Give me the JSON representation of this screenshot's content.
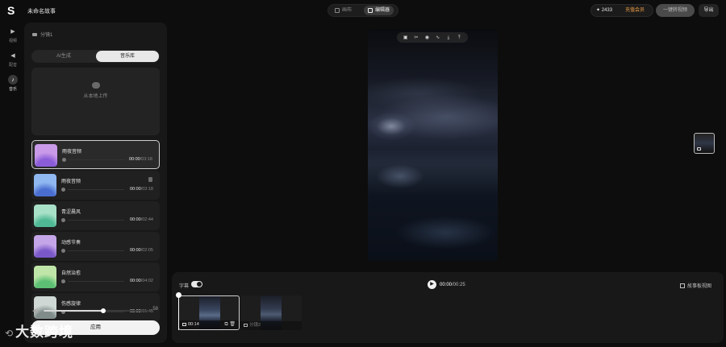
{
  "app": {
    "logo": "S",
    "project_title": "未命名故事"
  },
  "header": {
    "modes": [
      {
        "label": "画布"
      },
      {
        "label": "编辑器"
      }
    ],
    "credits": "✦ 2433",
    "vip": "充值会员",
    "generate": "一键转视频",
    "export": "导出"
  },
  "rail": [
    {
      "label": "视频",
      "icon": "video-icon"
    },
    {
      "label": "配音",
      "icon": "voice-icon"
    },
    {
      "label": "音乐",
      "icon": "music-icon"
    }
  ],
  "panel": {
    "heading": "分镜1",
    "tabs": [
      {
        "label": "AI生成"
      },
      {
        "label": "音乐库"
      }
    ],
    "upload": "从本地上传",
    "tracks": [
      {
        "name": "雨夜音频",
        "current": "00:00",
        "duration": "/03:18",
        "colors": [
          "#8a5cd8",
          "#c99ae8"
        ]
      },
      {
        "name": "雨夜音频",
        "current": "00:00",
        "duration": "/03:18",
        "colors": [
          "#4a6ed0",
          "#8fb8f0"
        ]
      },
      {
        "name": "青涩晨风",
        "current": "00:00",
        "duration": "/02:44",
        "colors": [
          "#4fb894",
          "#a8e0c8"
        ]
      },
      {
        "name": "动感节奏",
        "current": "00:00",
        "duration": "/02:05",
        "colors": [
          "#7a58c8",
          "#c4a6e8"
        ]
      },
      {
        "name": "自然治愈",
        "current": "00:00",
        "duration": "/04:02",
        "colors": [
          "#5cbf74",
          "#bfe6a8"
        ]
      },
      {
        "name": "伤感旋律",
        "current": "00:00",
        "duration": "/01:45",
        "colors": [
          "#7f8c8a",
          "#cfd8d4"
        ]
      }
    ],
    "volume": 58,
    "volume_label": "58",
    "apply": "应用"
  },
  "timeline": {
    "subtitle_label": "字幕",
    "current": "00:00",
    "total": "/00:25",
    "storyboard": "故事板视图",
    "clips": [
      {
        "label": "00:14"
      },
      {
        "label": "分镜2"
      }
    ]
  },
  "watermark": "大数跨境"
}
